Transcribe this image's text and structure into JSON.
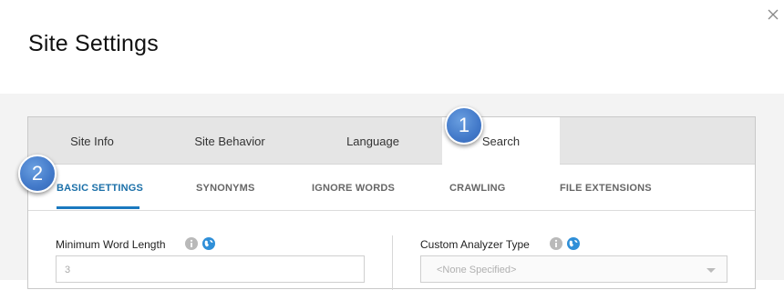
{
  "dialog": {
    "title": "Site Settings",
    "close_label": "×"
  },
  "tabs": [
    {
      "label": "Site Info",
      "active": false
    },
    {
      "label": "Site Behavior",
      "active": false
    },
    {
      "label": "Language",
      "active": false
    },
    {
      "label": "Search",
      "active": true
    }
  ],
  "subtabs": [
    {
      "label": "BASIC SETTINGS",
      "active": true
    },
    {
      "label": "SYNONYMS",
      "active": false
    },
    {
      "label": "IGNORE WORDS",
      "active": false
    },
    {
      "label": "CRAWLING",
      "active": false
    },
    {
      "label": "FILE EXTENSIONS",
      "active": false
    }
  ],
  "fields": {
    "min_word_length": {
      "label": "Minimum Word Length",
      "value": "3"
    },
    "custom_analyzer": {
      "label": "Custom Analyzer Type",
      "value": "<None Specified>"
    }
  },
  "callouts": [
    "1",
    "2"
  ],
  "colors": {
    "accent": "#1a79bf",
    "callout": "#4279c9",
    "info_icon": "#b9b9b9",
    "globe_icon": "#2f8fd8"
  }
}
